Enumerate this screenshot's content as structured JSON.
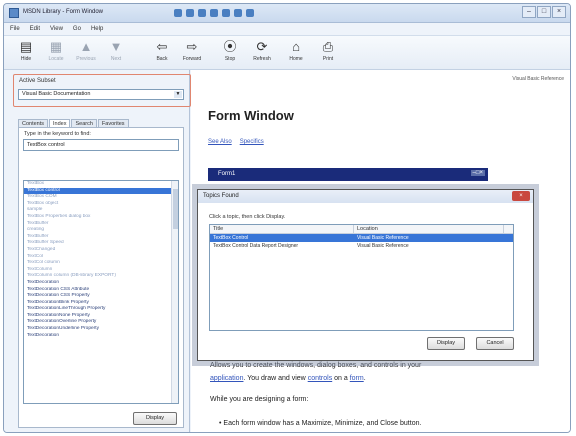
{
  "window": {
    "title": "MSDN Library - Form Window",
    "controls": [
      "–",
      "□",
      "×"
    ]
  },
  "menu": [
    "File",
    "Edit",
    "View",
    "Go",
    "Help"
  ],
  "toolbar": [
    {
      "label": "Hide",
      "icon": "hide-icon",
      "glyph": "▤",
      "enabled": true
    },
    {
      "label": "Locate",
      "icon": "locate-icon",
      "glyph": "▦",
      "enabled": false
    },
    {
      "label": "Previous",
      "icon": "previous-icon",
      "glyph": "▲",
      "enabled": false
    },
    {
      "label": "Next",
      "icon": "next-icon",
      "glyph": "▼",
      "enabled": false
    },
    {
      "label": "Back",
      "icon": "back-icon",
      "glyph": "⇦",
      "enabled": true
    },
    {
      "label": "Forward",
      "icon": "forward-icon",
      "glyph": "⇨",
      "enabled": true
    },
    {
      "label": "Stop",
      "icon": "stop-icon",
      "glyph": "⦿",
      "enabled": true
    },
    {
      "label": "Refresh",
      "icon": "refresh-icon",
      "glyph": "⟳",
      "enabled": true
    },
    {
      "label": "Home",
      "icon": "home-icon",
      "glyph": "⌂",
      "enabled": true
    },
    {
      "label": "Print",
      "icon": "print-icon",
      "glyph": "⎙",
      "enabled": true
    }
  ],
  "active_subset": {
    "label": "Active Subset",
    "value": "Visual Basic Documentation"
  },
  "nav_tabs": [
    "Contents",
    "Index",
    "Search",
    "Favorites"
  ],
  "index": {
    "keyword_label": "Type in the keyword to find:",
    "keyword_value": "TextBox control",
    "items": [
      "TextBox",
      "TextBox control",
      "TextBox COM",
      "TextBox object",
      "sample",
      "TextBox Properties dialog box",
      "TextBuffer",
      "creating",
      "TextBuffer",
      "TextBuffer Speed",
      "TextChanged",
      "TextCol",
      "TextCol column",
      "TextColumn",
      "TextColumn column (DB-library EXPORT)",
      "TextDecoration",
      "TextDecoration CSS Attribute",
      "TextDecoration CSS Property",
      "TextDecorationBlink Property",
      "TextDecorationLineThrough Property",
      "TextDecorationNone Property",
      "TextDecorationOverline Property",
      "TextDecorationUnderline Property",
      "TextDecoration"
    ],
    "display_button": "Display"
  },
  "content": {
    "breadcrumb": "Visual Basic Reference",
    "title": "Form Window",
    "links": [
      "See Also",
      "Specifics"
    ],
    "form_caption": "Form1",
    "form_controls": "–□×",
    "line1_pre": "Allows you to create the windows, dialog boxes, and controls in your",
    "line2_link1": "application",
    "line2_mid": ". You draw and view ",
    "line2_link2": "controls",
    "line2_mid2": " on a ",
    "line2_link3": "form",
    "line2_end": ".",
    "para2": "While you are designing a form:",
    "bullet1": "•  Each form window has a Maximize, Minimize, and Close button."
  },
  "dialog": {
    "title": "Topics Found",
    "close": "×",
    "instruction": "Click a topic, then click Display.",
    "columns": [
      "Title",
      "Location"
    ],
    "rows": [
      {
        "title": "TextBox Control",
        "location": "Visual Basic Reference"
      },
      {
        "title": "TextBox Control Data Report Designer",
        "location": "Visual Basic Reference"
      }
    ],
    "display_button": "Display",
    "cancel_button": "Cancel"
  }
}
